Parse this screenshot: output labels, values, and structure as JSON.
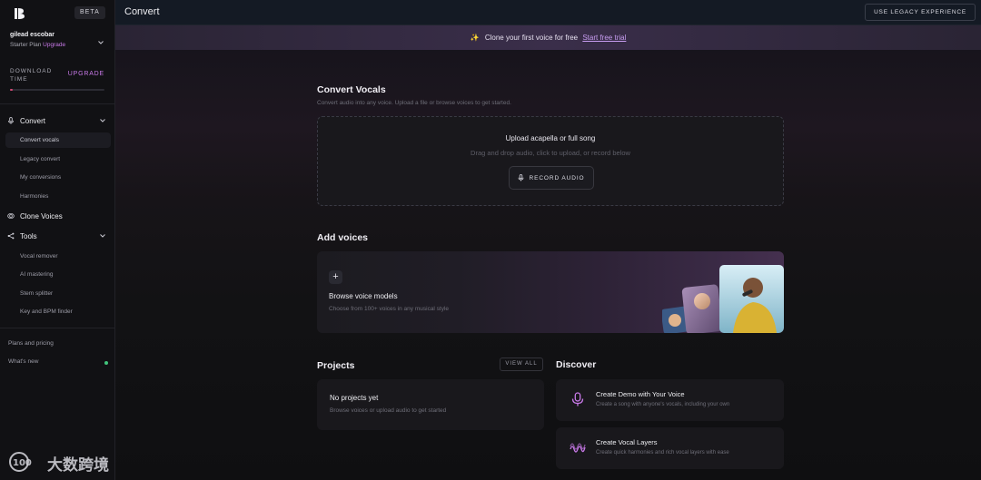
{
  "sidebar": {
    "beta_label": "BETA",
    "user": {
      "name": "gilead escobar",
      "plan": "Starter Plan",
      "upgrade": "Upgrade"
    },
    "download": {
      "label": "DOWNLOAD TIME",
      "upgrade": "UPGRADE",
      "progress_fraction": 0.03
    },
    "convert": {
      "label": "Convert",
      "items": [
        {
          "label": "Convert vocals"
        },
        {
          "label": "Legacy convert"
        },
        {
          "label": "My conversions"
        },
        {
          "label": "Harmonies"
        }
      ]
    },
    "clone_voices": {
      "label": "Clone Voices"
    },
    "tools": {
      "label": "Tools",
      "items": [
        {
          "label": "Vocal remover"
        },
        {
          "label": "AI mastering"
        },
        {
          "label": "Stem splitter"
        },
        {
          "label": "Key and BPM finder"
        }
      ]
    },
    "footer": {
      "plans": "Plans and pricing",
      "whats_new": "What's new"
    }
  },
  "topbar": {
    "title": "Convert",
    "legacy_button": "USE LEGACY EXPERIENCE"
  },
  "promo": {
    "text": "Clone your first voice for free",
    "link": "Start free trial"
  },
  "convert_vocals": {
    "title": "Convert Vocals",
    "subtitle": "Convert audio into any voice. Upload a file or browse voices to get started.",
    "upload_title": "Upload acapella or full song",
    "upload_sub": "Drag and drop audio, click to upload, or record below",
    "record_button": "RECORD AUDIO"
  },
  "add_voices": {
    "title": "Add voices",
    "card_title": "Browse voice models",
    "card_sub": "Choose from 100+ voices in any musical style"
  },
  "projects": {
    "title": "Projects",
    "view_all": "VIEW ALL",
    "empty_title": "No projects yet",
    "empty_sub": "Browse voices or upload audio to get started"
  },
  "discover": {
    "title": "Discover",
    "items": [
      {
        "title": "Create Demo with Your Voice",
        "sub": "Create a song with anyone's vocals, including your own",
        "icon": "microphone-icon"
      },
      {
        "title": "Create Vocal Layers",
        "sub": "Create quick harmonies and rich vocal layers with ease",
        "icon": "waveform-icon"
      }
    ]
  },
  "watermark": {
    "text": "大数跨境"
  },
  "colors": {
    "accent": "#c879e8",
    "progress": "#d44a74",
    "online_dot": "#41c47b"
  }
}
